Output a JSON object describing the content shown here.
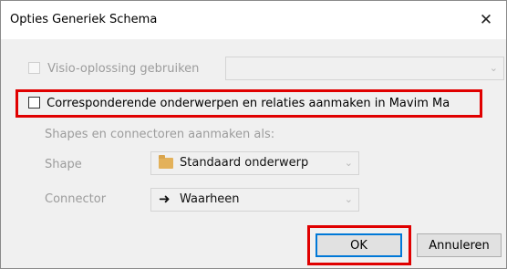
{
  "dialog": {
    "title": "Opties Generiek Schema",
    "close_glyph": "✕"
  },
  "visio_option": {
    "label": "Visio-oplossing gebruiken",
    "checked": false,
    "enabled": false,
    "select_value": ""
  },
  "corresponding_option": {
    "label": "Corresponderende onderwerpen en relaties aanmaken in Mavim Ma",
    "checked": false,
    "enabled": true
  },
  "shapes_section": {
    "heading": "Shapes en connectoren aanmaken als:",
    "shape_label": "Shape",
    "shape_value": "Standaard onderwerp",
    "shape_icon": "folder-icon",
    "connector_label": "Connector",
    "connector_value": "Waarheen",
    "connector_icon": "arrow-right-icon"
  },
  "buttons": {
    "ok_label": "OK",
    "cancel_label": "Annuleren"
  },
  "highlight_color": "#e00000",
  "accent_color": "#0078d7"
}
